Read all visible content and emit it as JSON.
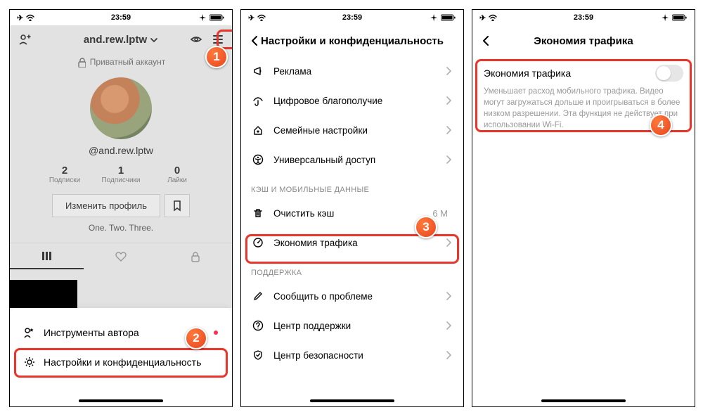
{
  "status": {
    "time": "23:59",
    "airplane": "✈",
    "wifi": "wifi",
    "loc": "loc",
    "batt": "batt"
  },
  "screen1": {
    "username": "and.rew.lptw",
    "private": "Приватный аккаунт",
    "handle": "@and.rew.lptw",
    "stats": [
      {
        "n": "2",
        "l": "Подписки"
      },
      {
        "n": "1",
        "l": "Подписчики"
      },
      {
        "n": "0",
        "l": "Лайки"
      }
    ],
    "edit": "Изменить профиль",
    "bio": "One. Two. Three.",
    "sheet": [
      {
        "icon": "star",
        "label": "Инструменты автора",
        "dot": true
      },
      {
        "icon": "gear",
        "label": "Настройки и конфиденциальность",
        "dot": false
      }
    ]
  },
  "screen2": {
    "title": "Настройки и конфиденциальность",
    "items1": [
      {
        "icon": "megaphone",
        "label": "Реклама"
      },
      {
        "icon": "umbrella",
        "label": "Цифровое благополучие"
      },
      {
        "icon": "home-heart",
        "label": "Семейные настройки"
      },
      {
        "icon": "accessibility",
        "label": "Универсальный доступ"
      }
    ],
    "section_cache": "КЭШ И МОБИЛЬНЫЕ ДАННЫЕ",
    "items2": [
      {
        "icon": "trash",
        "label": "Очистить кэш",
        "value": "6 M"
      },
      {
        "icon": "gauge",
        "label": "Экономия трафика"
      }
    ],
    "section_support": "ПОДДЕРЖКА",
    "items3": [
      {
        "icon": "pen",
        "label": "Сообщить о проблеме"
      },
      {
        "icon": "question",
        "label": "Центр поддержки"
      },
      {
        "icon": "shield",
        "label": "Центр безопасности"
      }
    ]
  },
  "screen3": {
    "title": "Экономия трафика",
    "row_title": "Экономия трафика",
    "desc": "Уменьшает расход мобильного трафика. Видео могут загружаться дольше и проигрываться в более низком разрешении. Эта функция не действует при использовании Wi-Fi."
  },
  "badges": {
    "b1": "1",
    "b2": "2",
    "b3": "3",
    "b4": "4"
  }
}
